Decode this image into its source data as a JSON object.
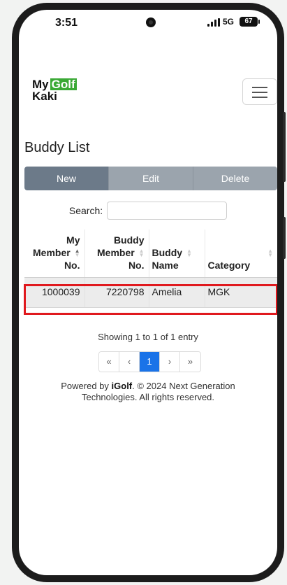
{
  "status_bar": {
    "time": "3:51",
    "network": "5G",
    "battery": "67"
  },
  "brand": {
    "line1_a": "My",
    "line1_b": "Golf",
    "line2": "Kaki"
  },
  "page_title": "Buddy List",
  "actions": {
    "new": "New",
    "edit": "Edit",
    "delete": "Delete"
  },
  "search": {
    "label": "Search:",
    "value": ""
  },
  "table": {
    "headers": {
      "member_no": [
        "My",
        "Member",
        "No."
      ],
      "buddy_member_no": [
        "Buddy",
        "Member",
        "No."
      ],
      "buddy_name": [
        "Buddy",
        "Name"
      ],
      "category": "Category"
    },
    "rows": [
      {
        "member_no": "1000039",
        "buddy_member_no": "7220798",
        "buddy_name": "Amelia",
        "category": "MGK"
      }
    ]
  },
  "pagination": {
    "info": "Showing 1 to 1 of 1 entry",
    "first": "«",
    "prev": "‹",
    "page": "1",
    "next": "›",
    "last": "»"
  },
  "footer": {
    "prefix": "Powered by",
    "brand": "iGolf",
    "suffix": ". © 2024 Next Generation",
    "line2": "Technologies. All rights reserved."
  },
  "colors": {
    "accent": "#1a73e8",
    "brand_green": "#3aa935",
    "highlight": "#e0191e"
  }
}
